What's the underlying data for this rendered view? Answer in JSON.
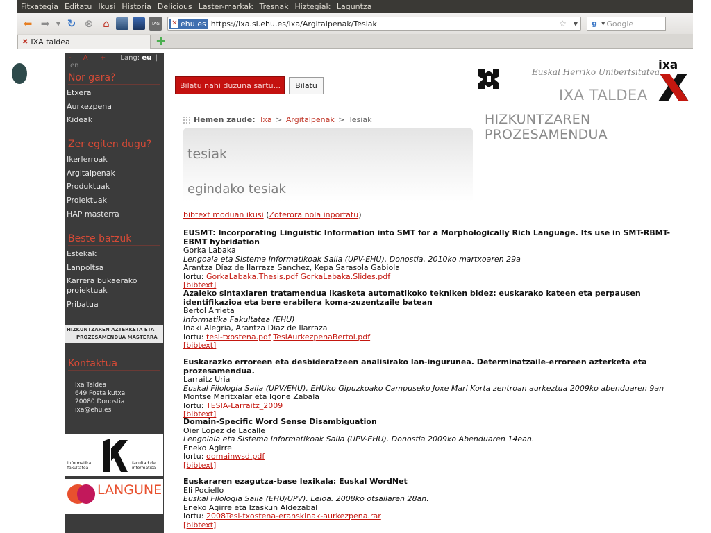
{
  "browser": {
    "menu": [
      "Fitxategia",
      "Editatu",
      "Ikusi",
      "Historia",
      "Delicious",
      "Laster-markak",
      "Tresnak",
      "Hiztegiak",
      "Laguntza"
    ],
    "site_badge": "ehu.es",
    "url": "https://ixa.si.ehu.es/Ixa/Argitalpenak/Tesiak",
    "search_placeholder": "Google",
    "tab_title": "IXA taldea"
  },
  "sidebar": {
    "font_controls": [
      "-",
      "A",
      "+"
    ],
    "lang_label": "Lang:",
    "lang_current": "eu",
    "lang_sep": "|",
    "lang_other": "en",
    "sections": [
      {
        "title": "Nor gara?",
        "items": [
          "Etxera",
          "Aurkezpena",
          "Kideak"
        ]
      },
      {
        "title": "Zer egiten dugu?",
        "items": [
          "Ikerlerroak",
          "Argitalpenak",
          "Produktuak",
          "Proiektuak",
          "HAP masterra"
        ]
      },
      {
        "title": "Beste batzuk",
        "items": [
          "Estekak",
          "Lanpoltsa",
          "Karrera bukaerako proiektuak",
          "Pribatua"
        ]
      },
      {
        "title": "Kontaktua",
        "items": []
      }
    ],
    "masterra_banner": [
      "HIZKUNTZAREN AZTERKETA ETA",
      "PROZESAMENDUA MASTERRA"
    ],
    "contact": [
      "Ixa Taldea",
      "649 Posta kutxa",
      "20080 Donostia",
      "ixa@ehu.es"
    ],
    "logos": {
      "informatika_left": [
        "informatika",
        "fakultatea"
      ],
      "informatika_right": [
        "facultad de",
        "informática"
      ],
      "langune": "LANGUNE"
    }
  },
  "header": {
    "search_placeholder": "Bilatu nahi duzuna sartu...",
    "search_button": "Bilatu",
    "university": "Euskal Herriko Unibertsitatea",
    "group": "IXA TALDEA",
    "group_subtitle": "HIZKUNTZAREN PROZESAMENDUA",
    "ixa_logo_text": "ixa"
  },
  "breadcrumb": {
    "label": "Hemen zaude:",
    "items": [
      "Ixa",
      "Argitalpenak",
      "Tesiak"
    ],
    "sep": ">"
  },
  "page": {
    "title": "tesiak",
    "subtitle": "egindako tesiak"
  },
  "intro": {
    "bibtex_link": "bibtext moduan ikusi",
    "zotero_link": "Zoterora nola inportatu",
    "open": "(",
    "close": ")"
  },
  "theses": [
    {
      "title": "EUSMT: Incorporating Linguistic Information into SMT for a Morphologically Rich Language. Its use in SMT-RBMT-EBMT hybridation",
      "author": "Gorka Labaka",
      "place": "Lengoaia eta Sistema Informatikoak Saila (UPV-EHU). Donostia. 2010ko martxoaren 29a",
      "advisors": "Arantza Díaz de Ilarraza Sanchez, Kepa Sarasola Gabiola",
      "files_label": "Iortu:",
      "files": [
        "GorkaLabaka.Thesis.pdf",
        "GorkaLabaka.Slides.pdf"
      ],
      "bibtex": "[bibtext]"
    },
    {
      "title": "Azaleko sintaxiaren tratamendua ikasketa automatikoko tekniken bidez: euskarako kateen eta perpausen identifikazioa eta bere erabilera koma-zuzentzaile batean",
      "author": "Bertol Arrieta",
      "place": "Informatika Fakultatea (EHU)",
      "advisors": "Iñaki Alegria, Arantza Diaz de Ilarraza",
      "files_label": "Iortu:",
      "files": [
        "tesi-txostena.pdf",
        "TesiAurkezpenaBertol.pdf"
      ],
      "bibtex": "[bibtext]"
    },
    {
      "title": "Euskarazko erroreen eta desbideratzeen analisirako lan-ingurunea. Determinatzaile-erroreen azterketa eta prozesamendua.",
      "author": "Larraitz Uria",
      "place": "Euskal Filologia Saila (UPV/EHU). EHUko Gipuzkoako Campuseko Joxe Mari Korta zentroan aurkeztua 2009ko abenduaren 9an",
      "advisors": "Montse Maritxalar eta Igone Zabala",
      "files_label": "Iortu:",
      "files": [
        "TESIA-Larraitz_2009"
      ],
      "bibtex": "[bibtext]"
    },
    {
      "title": "Domain-Specific Word Sense Disambiguation",
      "author": "Oier Lopez de Lacalle",
      "place": "Lengoiaia eta Sistema Informatikoak Saila (UPV-EHU). Donostia 2009ko Abenduaren 14ean.",
      "advisors": "Eneko Agirre",
      "files_label": "Iortu:",
      "files": [
        "domainwsd.pdf"
      ],
      "bibtex": "[bibtext]"
    },
    {
      "title": "Euskararen ezagutza-base lexikala: Euskal WordNet",
      "author": "Eli Pociello",
      "place": "Euskal Filologia Saila (EHU/UPV). Leioa. 2008ko otsailaren 28an.",
      "advisors": "Eneko Agirre eta Izaskun Aldezabal",
      "files_label": "Iortu:",
      "files": [
        "2008Tesi-txostena-eranskinak-aurkezpena.rar"
      ],
      "bibtex": "[bibtext]"
    }
  ],
  "colors": {
    "accent": "#c4170f",
    "sidebar_bg": "#3b3b3b",
    "section_title": "#d64a36"
  }
}
